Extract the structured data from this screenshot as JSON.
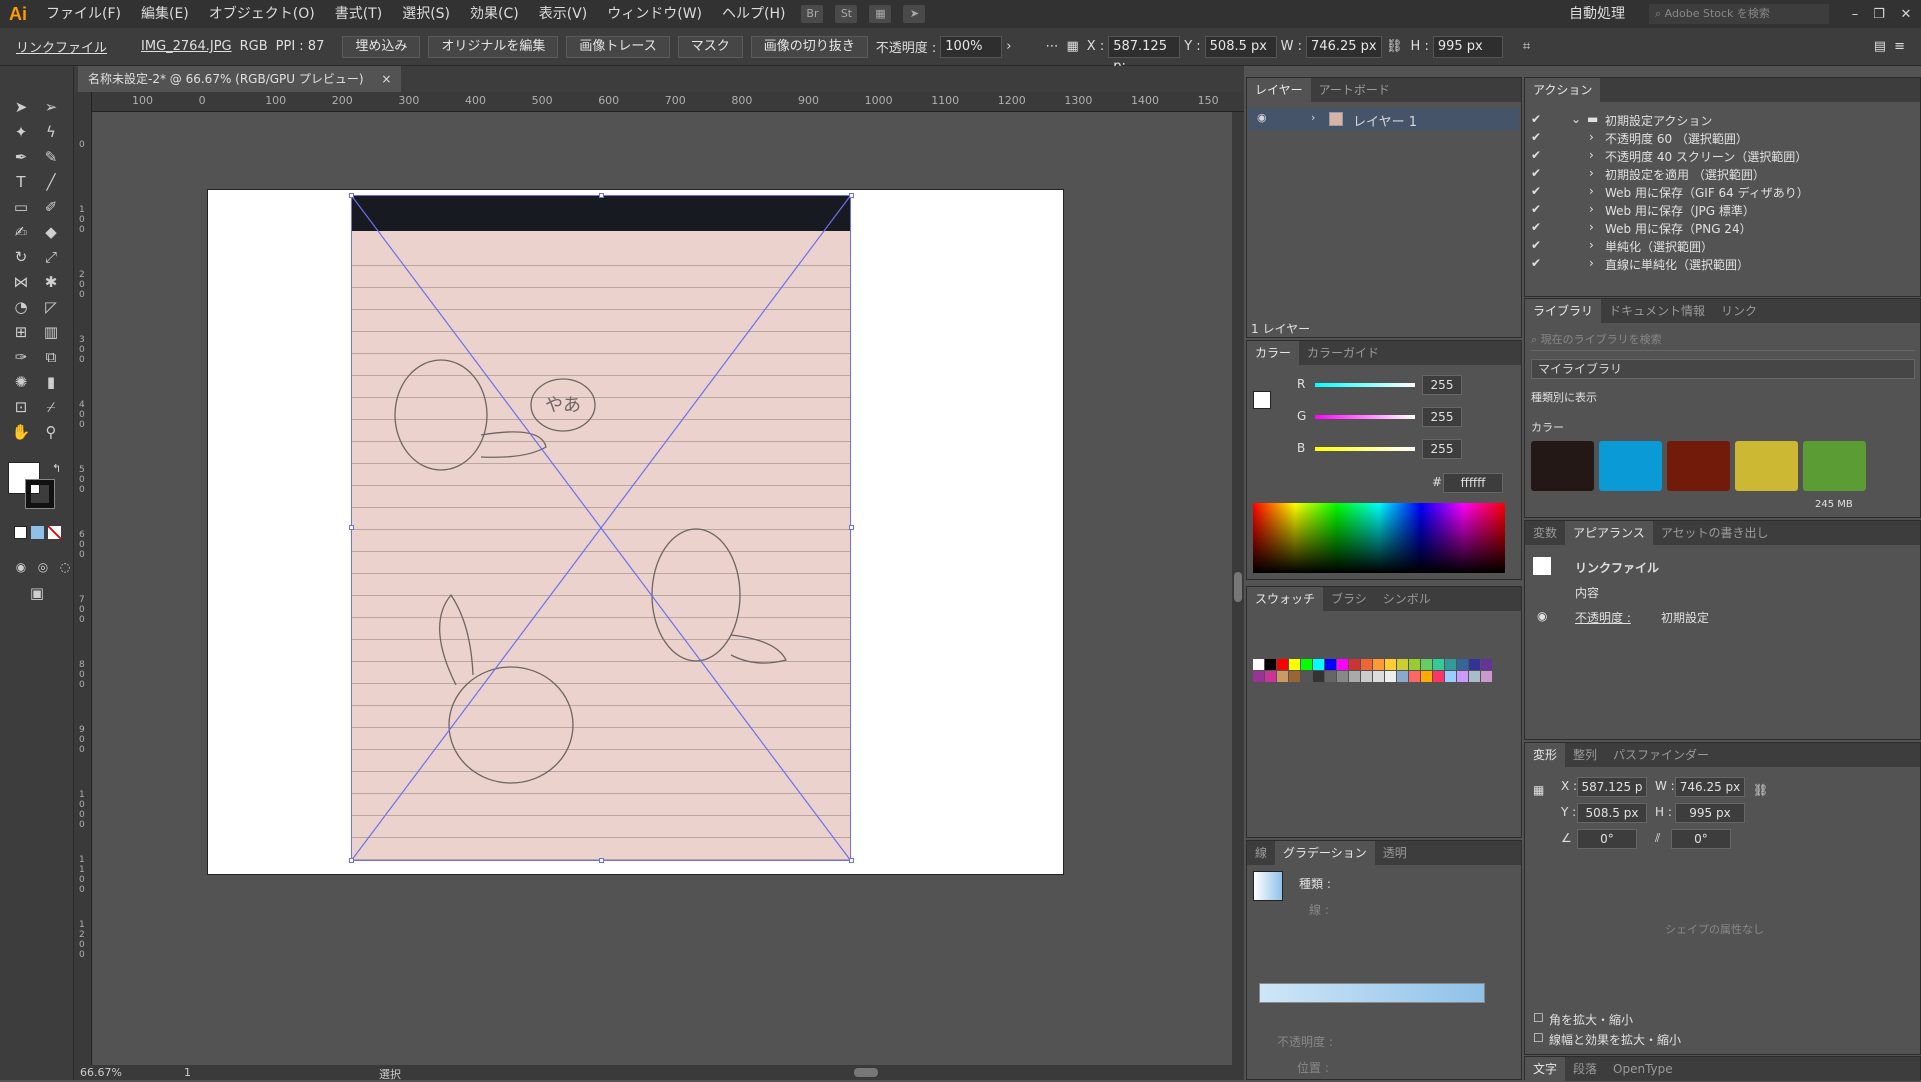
{
  "app": {
    "logo": "Ai"
  },
  "menu": [
    "ファイル(F)",
    "編集(E)",
    "オブジェクト(O)",
    "書式(T)",
    "選択(S)",
    "効果(C)",
    "表示(V)",
    "ウィンドウ(W)",
    "ヘルプ(H)"
  ],
  "menu_right": {
    "workspace": "自動処理",
    "stock_search_placeholder": "Adobe Stock を検索"
  },
  "control": {
    "link_label": "リンクファイル",
    "filename": "IMG_2764.JPG",
    "colormode": "RGB",
    "ppi": "PPI : 87",
    "embed": "埋め込み",
    "edit_original": "オリジナルを編集",
    "image_trace": "画像トレース",
    "mask": "マスク",
    "crop": "画像の切り抜き",
    "opacity_label": "不透明度 :",
    "opacity": "100%",
    "x_label": "X :",
    "x": "587.125 p:",
    "y_label": "Y :",
    "y": "508.5 px",
    "w_label": "W :",
    "w": "746.25 px",
    "h_label": "H :",
    "h": "995 px"
  },
  "document": {
    "tab": "名称未設定-2* @ 66.67% (RGB/GPU プレビュー)",
    "close": "×"
  },
  "ruler": {
    "h": [
      "100",
      "0",
      "100",
      "200",
      "300",
      "400",
      "500",
      "600",
      "700",
      "800",
      "900",
      "1000",
      "1100",
      "1200",
      "1300",
      "1400",
      "150"
    ],
    "v": [
      "0",
      "1 0 0",
      "2 0 0",
      "3 0 0",
      "4 0 0",
      "5 0 0",
      "6 0 0",
      "7 0 0",
      "8 0 0",
      "9 0 0",
      "1 0 0 0",
      "1 1 0 0",
      "1 2 0 0"
    ]
  },
  "artwork": {
    "bubble": "やあ"
  },
  "status": {
    "zoom": "66.67%",
    "page": "1",
    "mode": "選択"
  },
  "layers": {
    "tabs": [
      "レイヤー",
      "アートボード"
    ],
    "layer": "レイヤー 1",
    "count": "1 レイヤー"
  },
  "color": {
    "tabs": [
      "カラー",
      "カラーガイド"
    ],
    "r_label": "R",
    "g_label": "G",
    "b_label": "B",
    "r": "255",
    "g": "255",
    "b": "255",
    "hex_label": "#",
    "hex": "ffffff"
  },
  "swatches": {
    "tabs": [
      "スウォッチ",
      "ブラシ",
      "シンボル"
    ]
  },
  "gradient": {
    "tabs": [
      "線",
      "グラデーション",
      "透明"
    ],
    "type_label": "種類 :",
    "line_label": "線 :",
    "opacity_label": "不透明度 :",
    "position_label": "位置 :"
  },
  "actions": {
    "tab": "アクション",
    "set": "初期設定アクション",
    "items": [
      "不透明度 60 （選択範囲）",
      "不透明度 40 スクリーン（選択範囲）",
      "初期設定を適用 （選択範囲）",
      "Web 用に保存（GIF 64 ディザあり）",
      "Web 用に保存（JPG 標準）",
      "Web 用に保存（PNG 24）",
      "単純化（選択範囲）",
      "直線に単純化（選択範囲）"
    ]
  },
  "library": {
    "tabs": [
      "ライブラリ",
      "ドキュメント情報",
      "リンク"
    ],
    "search_placeholder": "現在のライブラリを検索",
    "library": "マイライブラリ",
    "view_by": "種類別に表示",
    "color_section": "カラー",
    "size": "245 MB",
    "colors": [
      "#231816",
      "#0a9ad6",
      "#731b0a",
      "#cdb834",
      "#5c9c34"
    ]
  },
  "appearance": {
    "tabs": [
      "変数",
      "アピアランス",
      "アセットの書き出し"
    ],
    "title": "リンクファイル",
    "contents": "内容",
    "opacity_label": "不透明度 :",
    "opacity": "初期設定"
  },
  "transform": {
    "tabs": [
      "変形",
      "整列",
      "パスファインダー"
    ],
    "x_label": "X :",
    "x": "587.125 p",
    "y_label": "Y :",
    "y": "508.5 px",
    "w_label": "W :",
    "w": "746.25 px",
    "h_label": "H :",
    "h": "995 px",
    "angle": "0°",
    "shear": "0°",
    "no_shape": "シェイプの属性なし",
    "scale_corners": "角を拡大・縮小",
    "scale_strokes": "線幅と効果を拡大・縮小"
  },
  "character": {
    "tabs": [
      "文字",
      "段落",
      "OpenType"
    ]
  }
}
